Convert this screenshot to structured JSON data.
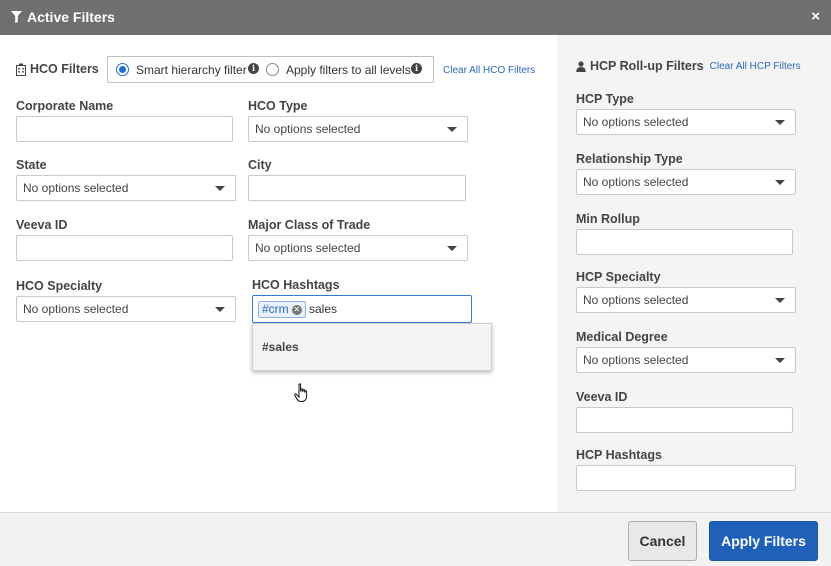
{
  "header": {
    "title": "Active Filters",
    "close_icon": "×"
  },
  "hco": {
    "title": "HCO Filters",
    "radio_smart": "Smart hierarchy filter",
    "radio_all": "Apply filters to all levels",
    "clear_link": "Clear All HCO Filters",
    "fields": {
      "corporate_name": "Corporate Name",
      "hco_type": "HCO Type",
      "state": "State",
      "city": "City",
      "veeva_id": "Veeva ID",
      "major_class": "Major Class of Trade",
      "specialty": "HCO Specialty",
      "hashtags": "HCO Hashtags"
    },
    "placeholder": "No options selected",
    "hashtag_chip": "#crm",
    "hashtag_typed": "sales",
    "dropdown_option": "#sales"
  },
  "hcp": {
    "title": "HCP Roll-up Filters",
    "clear_link": "Clear All HCP Filters",
    "fields": {
      "hcp_type": "HCP Type",
      "relationship_type": "Relationship Type",
      "min_rollup": "Min Rollup",
      "specialty": "HCP Specialty",
      "medical_degree": "Medical Degree",
      "veeva_id": "Veeva ID",
      "hashtags": "HCP Hashtags"
    },
    "placeholder": "No options selected"
  },
  "footer": {
    "cancel": "Cancel",
    "apply": "Apply Filters"
  }
}
